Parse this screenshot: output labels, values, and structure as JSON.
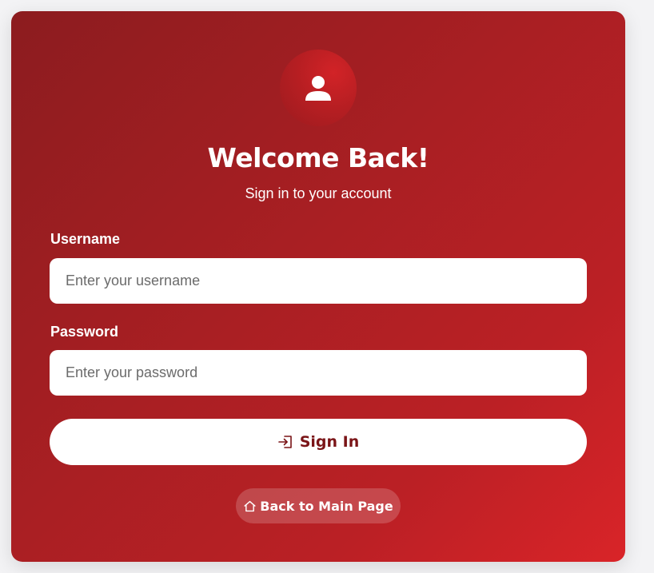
{
  "header": {
    "title": "Welcome Back!",
    "subtitle": "Sign in to your account"
  },
  "form": {
    "username": {
      "label": "Username",
      "placeholder": "Enter your username",
      "value": ""
    },
    "password": {
      "label": "Password",
      "placeholder": "Enter your password",
      "value": ""
    },
    "submit_label": "Sign In",
    "submit_icon": "sign-in-icon"
  },
  "footer": {
    "back_label": "Back to Main Page",
    "back_icon": "home-icon"
  },
  "icons": {
    "avatar": "user-icon"
  },
  "colors": {
    "card_gradient_start": "#8c1c1f",
    "card_gradient_end": "#d92428",
    "button_text": "#7a1417",
    "text": "#ffffff",
    "page_background": "#f3f3f5"
  }
}
